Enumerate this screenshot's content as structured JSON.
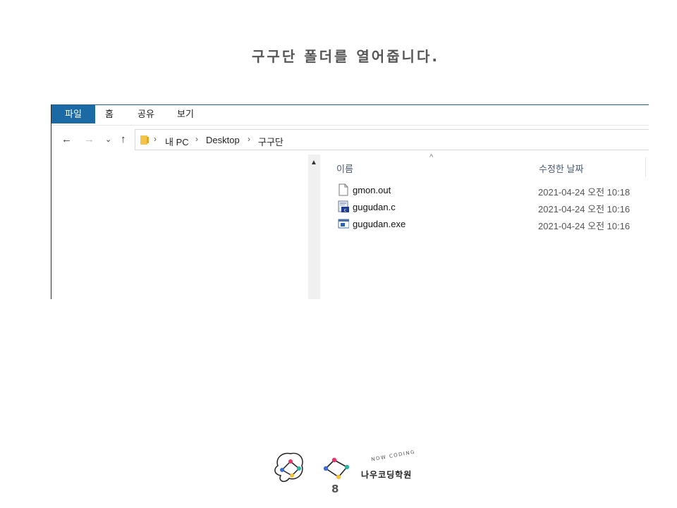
{
  "slide": {
    "title": "구구단 폴더를 열어줍니다.",
    "page_number": "8"
  },
  "ribbon": {
    "tabs": [
      {
        "label": "파일",
        "active": true
      },
      {
        "label": "홈",
        "active": false
      },
      {
        "label": "공유",
        "active": false
      },
      {
        "label": "보기",
        "active": false
      }
    ]
  },
  "nav": {
    "back_icon": "back-arrow-icon",
    "forward_icon": "forward-arrow-icon",
    "recent_icon": "chevron-down-icon",
    "up_icon": "up-arrow-icon"
  },
  "address": {
    "path": [
      "내 PC",
      "Desktop",
      "구구단"
    ]
  },
  "file_list": {
    "columns": {
      "name": "이름",
      "date": "수정한 날짜"
    },
    "files": [
      {
        "name": "gmon.out",
        "date": "2021-04-24 오전 10:18",
        "icon": "blank-file-icon"
      },
      {
        "name": "gugudan.c",
        "date": "2021-04-24 오전 10:16",
        "icon": "c-source-file-icon"
      },
      {
        "name": "gugudan.exe",
        "date": "2021-04-24 오전 10:16",
        "icon": "executable-file-icon"
      }
    ]
  },
  "logo": {
    "brand_name": "나우코딩학원",
    "tagline": "NOW CODING"
  },
  "colors": {
    "accent": "#1b6aa5",
    "title_text": "#555555"
  }
}
